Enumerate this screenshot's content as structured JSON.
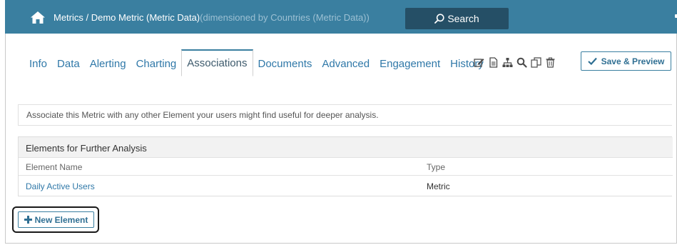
{
  "header": {
    "breadcrumb_main": "Metrics / Demo Metric (Metric Data)",
    "breadcrumb_dim": "(dimensioned by Countries (Metric Data))",
    "search_label": "Search",
    "accent_color": "#3a7fa0"
  },
  "tabs": [
    {
      "label": "Info",
      "active": false
    },
    {
      "label": "Data",
      "active": false
    },
    {
      "label": "Alerting",
      "active": false
    },
    {
      "label": "Charting",
      "active": false
    },
    {
      "label": "Associations",
      "active": true
    },
    {
      "label": "Documents",
      "active": false
    },
    {
      "label": "Advanced",
      "active": false
    },
    {
      "label": "Engagement",
      "active": false
    },
    {
      "label": "History",
      "active": false
    }
  ],
  "toolbar": {
    "icons": [
      "edit-icon",
      "document-icon",
      "hierarchy-icon",
      "search-icon",
      "copy-icon",
      "trash-icon"
    ],
    "save_label": "Save & Preview"
  },
  "info": {
    "text": "Associate this Metric with any other Element your users might find useful for deeper analysis."
  },
  "elements_table": {
    "title": "Elements for Further Analysis",
    "columns": [
      "Element Name",
      "Type"
    ],
    "rows": [
      {
        "name": "Daily Active Users",
        "type": "Metric"
      }
    ]
  },
  "new_element_label": "New Element"
}
